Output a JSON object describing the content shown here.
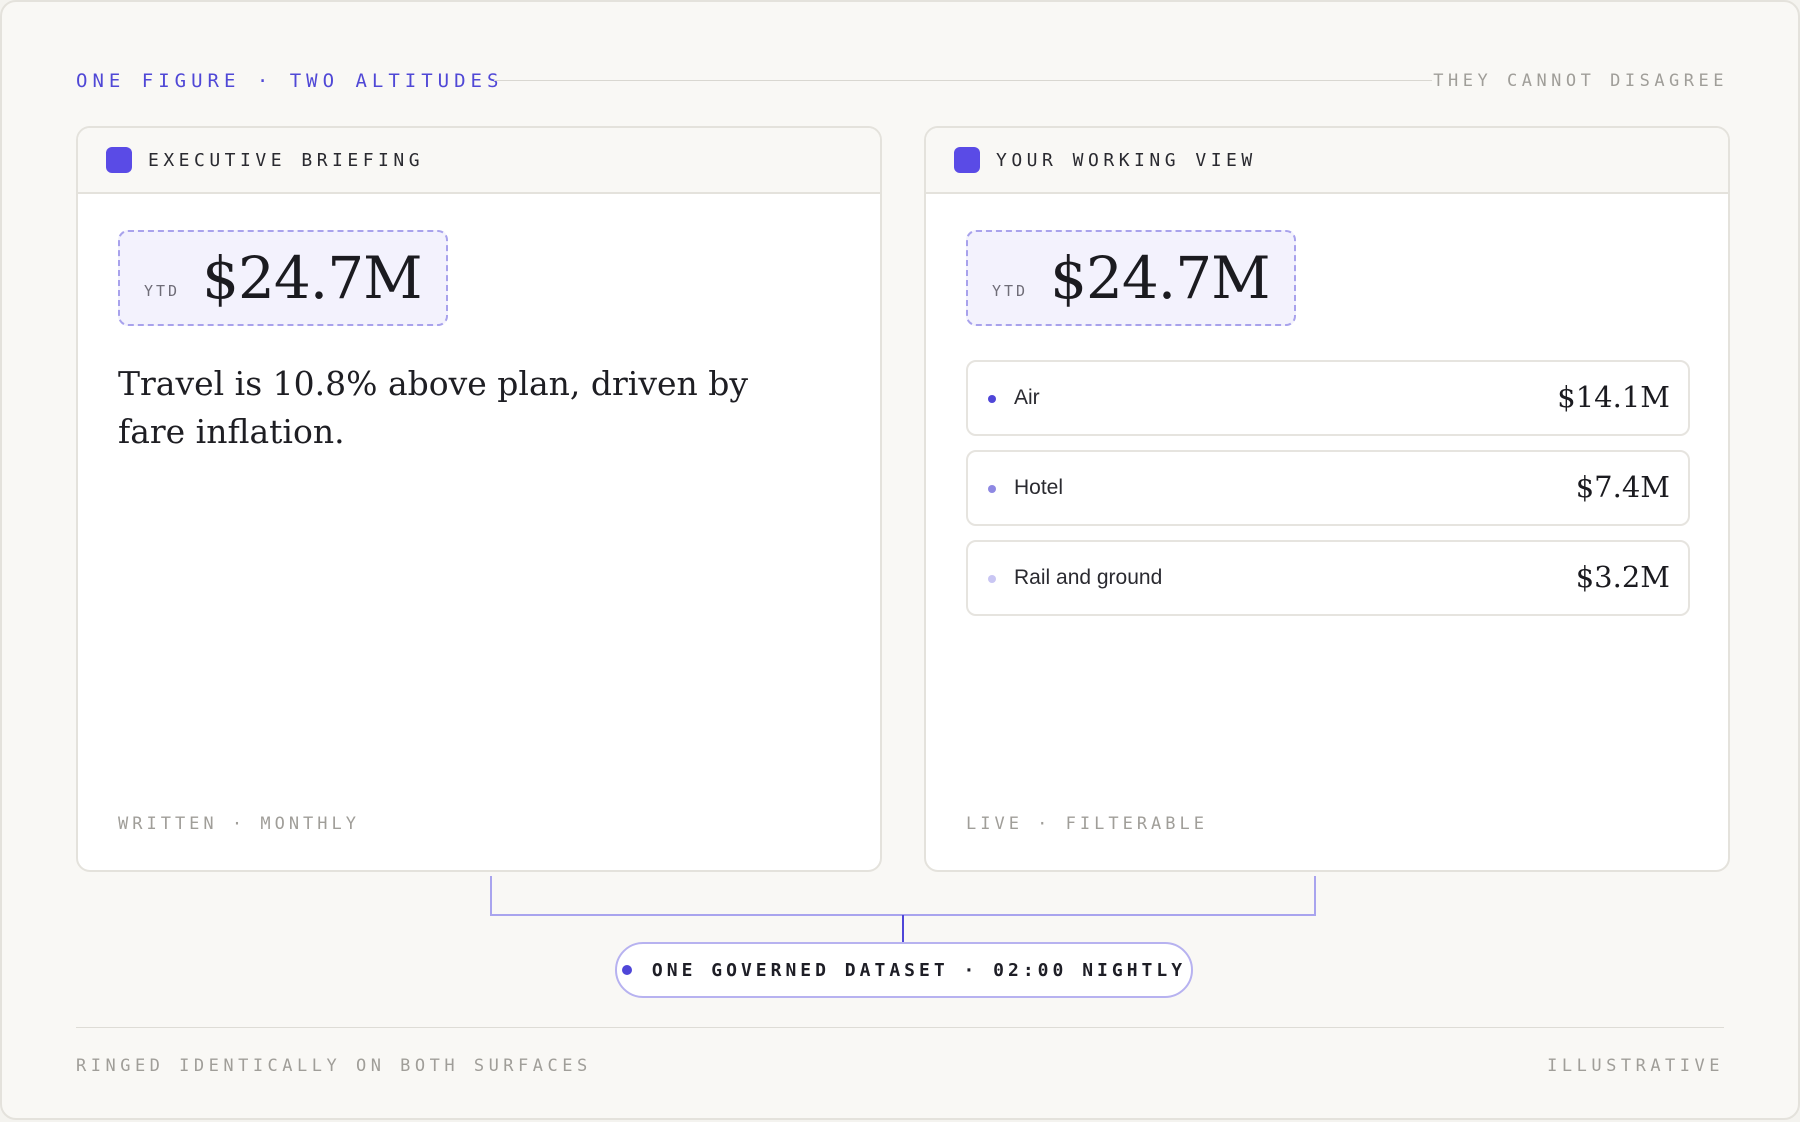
{
  "header": {
    "left": "ONE FIGURE · TWO ALTITUDES",
    "right": "THEY CANNOT DISAGREE"
  },
  "panels": {
    "executive": {
      "title": "EXECUTIVE BRIEFING",
      "kpi_label": "YTD",
      "kpi_value": "$24.7M",
      "narrative": "Travel is 10.8% above plan, driven by fare inflation.",
      "footer": "WRITTEN · MONTHLY"
    },
    "working": {
      "title": "YOUR WORKING VIEW",
      "kpi_label": "YTD",
      "kpi_value": "$24.7M",
      "items": [
        {
          "label": "Air",
          "value": "$14.1M",
          "dot_color": "#4f46d8"
        },
        {
          "label": "Hotel",
          "value": "$7.4M",
          "dot_color": "#8e88e3"
        },
        {
          "label": "Rail and ground",
          "value": "$3.2M",
          "dot_color": "#c9c6f3"
        }
      ],
      "footer": "LIVE · FILTERABLE"
    }
  },
  "dataset_pill": "ONE GOVERNED DATASET · 02:00 NIGHTLY",
  "footer": {
    "left": "RINGED IDENTICALLY ON BOTH SURFACES",
    "right": "ILLUSTRATIVE"
  },
  "colors": {
    "accent": "#5a4be6",
    "muted_text": "#a09e99",
    "connector": "#a9a4ee"
  }
}
